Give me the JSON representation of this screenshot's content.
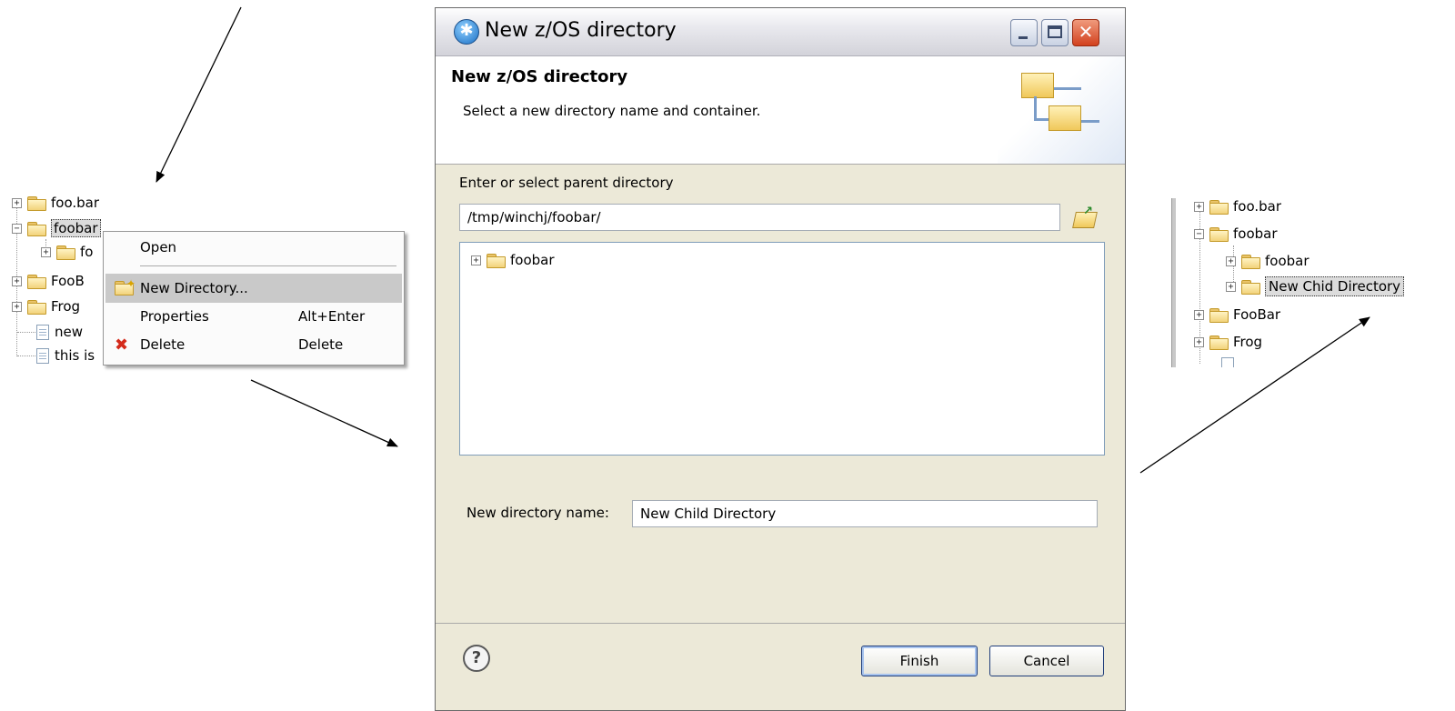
{
  "left_tree": {
    "items": [
      {
        "label": "foo.bar",
        "type": "folder",
        "expander": "+"
      },
      {
        "label": "foobar",
        "type": "folder",
        "expander": "−"
      },
      {
        "label": "fo",
        "type": "folder",
        "expander": "+"
      },
      {
        "label": "FooB",
        "type": "folder",
        "expander": "+"
      },
      {
        "label": "Frog",
        "type": "folder",
        "expander": "+"
      },
      {
        "label": "new",
        "type": "file"
      },
      {
        "label": "this is",
        "type": "file"
      }
    ]
  },
  "context_menu": {
    "items": [
      {
        "label": "Open",
        "accel": "",
        "icon": ""
      },
      {
        "label": "New Directory...",
        "accel": "",
        "icon": "new-folder-icon",
        "selected": true
      },
      {
        "label": "Properties",
        "accel": "Alt+Enter",
        "icon": ""
      },
      {
        "label": "Delete",
        "accel": "Delete",
        "icon": "delete-icon"
      }
    ]
  },
  "dialog": {
    "window_title": "New z/OS directory",
    "banner_title": "New z/OS directory",
    "banner_subtitle": "Select a new directory name and container.",
    "parent_label": "Enter or select parent directory",
    "parent_value": "/tmp/winchj/foobar/",
    "tree_items": [
      {
        "label": "foobar",
        "expander": "+"
      }
    ],
    "name_label": "New directory name:",
    "name_value": "New Child Directory",
    "help_glyph": "?",
    "finish_label": "Finish",
    "cancel_label": "Cancel"
  },
  "right_tree": {
    "items": [
      {
        "label": "foo.bar",
        "expander": "+"
      },
      {
        "label": "foobar",
        "expander": "−"
      },
      {
        "label": "foobar",
        "expander": "+"
      },
      {
        "label": "New Chid Directory",
        "expander": "+",
        "selected": true
      },
      {
        "label": "FooBar",
        "expander": "+"
      },
      {
        "label": "Frog",
        "expander": "+"
      }
    ]
  },
  "colors": {
    "dialog_bg": "#ece9d8",
    "close_button": "#d2411e",
    "menu_selection": "#c9c9c9",
    "folder": "#f2d27a"
  }
}
